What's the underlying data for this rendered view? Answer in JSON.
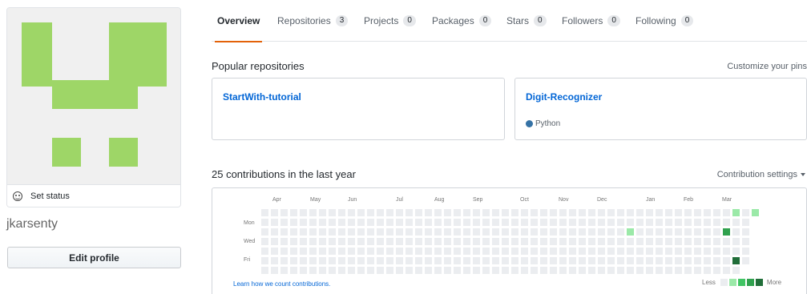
{
  "profile": {
    "set_status": "Set status",
    "username": "jkarsenty",
    "edit_profile": "Edit profile",
    "avatar_color": "#9ed667",
    "avatar_bg": "#f0f0f0"
  },
  "tabs": [
    {
      "label": "Overview",
      "count": null
    },
    {
      "label": "Repositories",
      "count": "3"
    },
    {
      "label": "Projects",
      "count": "0"
    },
    {
      "label": "Packages",
      "count": "0"
    },
    {
      "label": "Stars",
      "count": "0"
    },
    {
      "label": "Followers",
      "count": "0"
    },
    {
      "label": "Following",
      "count": "0"
    }
  ],
  "popular": {
    "title": "Popular repositories",
    "customize": "Customize your pins",
    "repos": [
      {
        "name": "StartWith-tutorial",
        "language": null
      },
      {
        "name": "Digit-Recognizer",
        "language": "Python",
        "language_color": "#3572a5"
      }
    ]
  },
  "contributions": {
    "title": "25 contributions in the last year",
    "settings_label": "Contribution settings",
    "months": [
      "Apr",
      "May",
      "Jun",
      "Jul",
      "Aug",
      "Sep",
      "Oct",
      "Nov",
      "Dec",
      "Jan",
      "Feb",
      "Mar"
    ],
    "day_labels": [
      "Mon",
      "Wed",
      "Fri"
    ],
    "learn_link": "Learn how we count contributions.",
    "legend_less": "Less",
    "legend_more": "More",
    "legend_colors": [
      "#ebedf0",
      "#9be9a8",
      "#40c463",
      "#30a14e",
      "#216e39"
    ],
    "active_days": [
      {
        "week": 38,
        "weekday": 2,
        "level": 1
      },
      {
        "week": 49,
        "weekday": 0,
        "level": 1
      },
      {
        "week": 48,
        "weekday": 2,
        "level": 3
      },
      {
        "week": 49,
        "weekday": 5,
        "level": 4
      }
    ]
  }
}
